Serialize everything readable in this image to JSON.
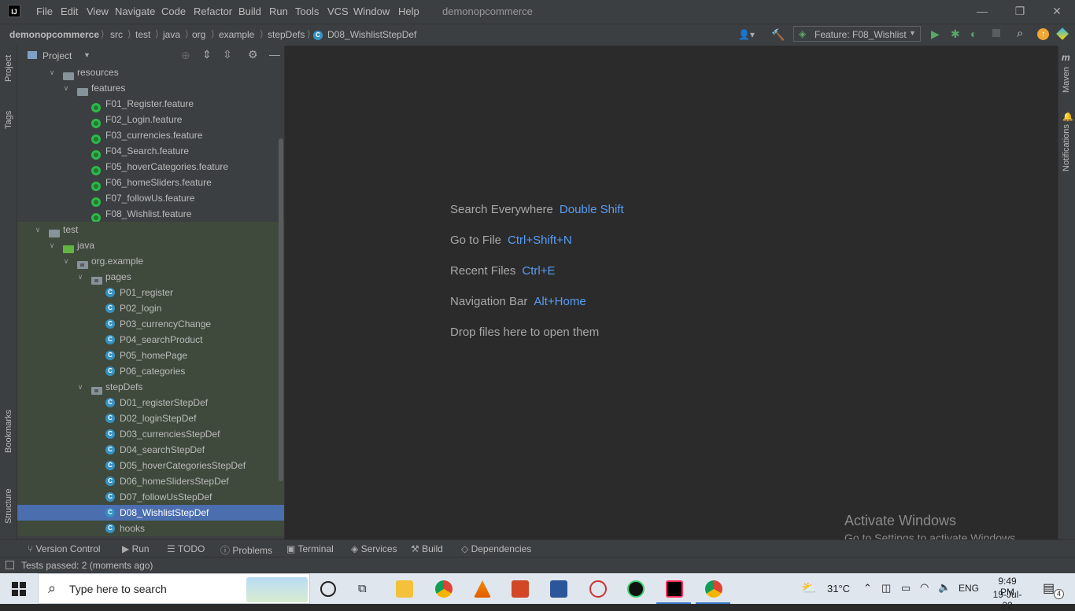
{
  "titlebar": {
    "logo": "IJ",
    "menu": [
      "File",
      "Edit",
      "View",
      "Navigate",
      "Code",
      "Refactor",
      "Build",
      "Run",
      "Tools",
      "VCS",
      "Window",
      "Help"
    ],
    "project_title": "demonopcommerce"
  },
  "navbar": {
    "breadcrumbs": [
      "demonopcommerce",
      "src",
      "test",
      "java",
      "org",
      "example",
      "stepDefs",
      "D08_WishlistStepDef"
    ],
    "run_config": "Feature: F08_Wishlist"
  },
  "left_strip": {
    "project": "Project",
    "tags": "Tags",
    "bookmarks": "Bookmarks",
    "structure": "Structure"
  },
  "right_strip": {
    "maven": "Maven",
    "notifications": "Notifications"
  },
  "project_panel": {
    "title": "Project",
    "tree": [
      {
        "label": "resources",
        "level": 3,
        "kind": "folder-res",
        "arrow": "down",
        "green": false
      },
      {
        "label": "features",
        "level": 4,
        "kind": "folder",
        "arrow": "down",
        "green": false
      },
      {
        "label": "F01_Register.feature",
        "level": 5,
        "kind": "feature",
        "arrow": "",
        "green": false
      },
      {
        "label": "F02_Login.feature",
        "level": 5,
        "kind": "feature",
        "arrow": "",
        "green": false
      },
      {
        "label": "F03_currencies.feature",
        "level": 5,
        "kind": "feature",
        "arrow": "",
        "green": false
      },
      {
        "label": "F04_Search.feature",
        "level": 5,
        "kind": "feature",
        "arrow": "",
        "green": false
      },
      {
        "label": "F05_hoverCategories.feature",
        "level": 5,
        "kind": "feature",
        "arrow": "",
        "green": false
      },
      {
        "label": "F06_homeSliders.feature",
        "level": 5,
        "kind": "feature",
        "arrow": "",
        "green": false
      },
      {
        "label": "F07_followUs.feature",
        "level": 5,
        "kind": "feature",
        "arrow": "",
        "green": false
      },
      {
        "label": "F08_Wishlist.feature",
        "level": 5,
        "kind": "feature",
        "arrow": "",
        "green": false
      },
      {
        "label": "test",
        "level": 2,
        "kind": "folder",
        "arrow": "down",
        "green": true
      },
      {
        "label": "java",
        "level": 3,
        "kind": "folder-green",
        "arrow": "down",
        "green": true
      },
      {
        "label": "org.example",
        "level": 4,
        "kind": "package",
        "arrow": "down",
        "green": true
      },
      {
        "label": "pages",
        "level": 5,
        "kind": "package",
        "arrow": "down",
        "green": true
      },
      {
        "label": "P01_register",
        "level": 6,
        "kind": "class",
        "arrow": "",
        "green": true
      },
      {
        "label": "P02_login",
        "level": 6,
        "kind": "class",
        "arrow": "",
        "green": true
      },
      {
        "label": "P03_currencyChange",
        "level": 6,
        "kind": "class",
        "arrow": "",
        "green": true
      },
      {
        "label": "P04_searchProduct",
        "level": 6,
        "kind": "class",
        "arrow": "",
        "green": true
      },
      {
        "label": "P05_homePage",
        "level": 6,
        "kind": "class",
        "arrow": "",
        "green": true
      },
      {
        "label": "P06_categories",
        "level": 6,
        "kind": "class",
        "arrow": "",
        "green": true
      },
      {
        "label": "stepDefs",
        "level": 5,
        "kind": "package",
        "arrow": "down",
        "green": true
      },
      {
        "label": "D01_registerStepDef",
        "level": 6,
        "kind": "class",
        "arrow": "",
        "green": true
      },
      {
        "label": "D02_loginStepDef",
        "level": 6,
        "kind": "class",
        "arrow": "",
        "green": true
      },
      {
        "label": "D03_currenciesStepDef",
        "level": 6,
        "kind": "class",
        "arrow": "",
        "green": true
      },
      {
        "label": "D04_searchStepDef",
        "level": 6,
        "kind": "class",
        "arrow": "",
        "green": true
      },
      {
        "label": "D05_hoverCategoriesStepDef",
        "level": 6,
        "kind": "class",
        "arrow": "",
        "green": true
      },
      {
        "label": "D06_homeSlidersStepDef",
        "level": 6,
        "kind": "class",
        "arrow": "",
        "green": true
      },
      {
        "label": "D07_followUsStepDef",
        "level": 6,
        "kind": "class",
        "arrow": "",
        "green": true
      },
      {
        "label": "D08_WishlistStepDef",
        "level": 6,
        "kind": "class",
        "arrow": "",
        "green": true,
        "selected": true
      },
      {
        "label": "hooks",
        "level": 6,
        "kind": "class",
        "arrow": "",
        "green": true
      }
    ]
  },
  "editor_hints": [
    {
      "text": "Search Everywhere",
      "key": "Double Shift"
    },
    {
      "text": "Go to File",
      "key": "Ctrl+Shift+N"
    },
    {
      "text": "Recent Files",
      "key": "Ctrl+E"
    },
    {
      "text": "Navigation Bar",
      "key": "Alt+Home"
    },
    {
      "text": "Drop files here to open them",
      "key": ""
    }
  ],
  "tool_tabs": [
    "Version Control",
    "Run",
    "TODO",
    "Problems",
    "Terminal",
    "Services",
    "Build",
    "Dependencies"
  ],
  "status": "Tests passed: 2 (moments ago)",
  "watermark": {
    "line1": "Activate Windows",
    "line2": "Go to Settings to activate Windows."
  },
  "taskbar": {
    "search_placeholder": "Type here to search",
    "temperature": "31°C",
    "language": "ENG",
    "time": "9:49 PM",
    "date": "19-Jul-22",
    "notification_count": "4"
  },
  "colors": {
    "accent": "#589df6",
    "selection": "#4b6eaf",
    "feature_green": "#2fb84b",
    "class_blue": "#3592c4"
  }
}
